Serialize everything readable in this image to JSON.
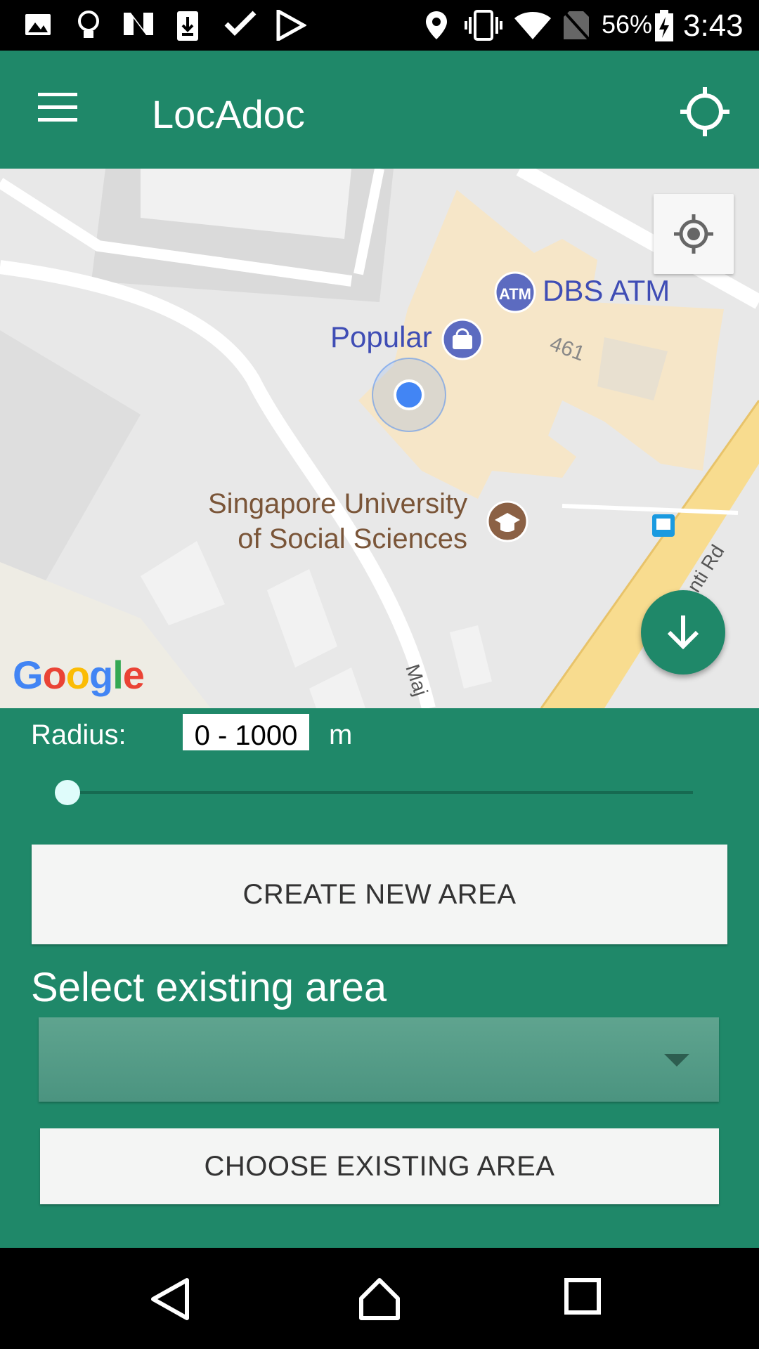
{
  "status_bar": {
    "battery": "56%",
    "time": "3:43",
    "icons": [
      "image-icon",
      "lightbulb-icon",
      "n-icon",
      "download-phone-icon",
      "check-icon",
      "play-store-icon",
      "location-icon",
      "vibrate-icon",
      "wifi-icon",
      "no-sim-icon",
      "battery-charging-icon"
    ]
  },
  "app_bar": {
    "title": "LocAdoc",
    "menu_icon": "hamburger-menu-icon",
    "action_icon": "crosshair-icon"
  },
  "map": {
    "poi_dbs": "DBS ATM",
    "poi_popular": "Popular",
    "poi_suss_line1": "Singapore University",
    "poi_suss_line2": "of Social Sciences",
    "building_number": "461",
    "road_label_1": "enti Rd",
    "road_label_2": "Maj",
    "google_logo": "Google"
  },
  "panel": {
    "radius_label": "Radius:",
    "radius_value": "0 - 1000",
    "radius_unit": "m",
    "slider_value": 0,
    "create_button": "CREATE NEW AREA",
    "select_label": "Select existing area",
    "dropdown_value": "",
    "choose_button": "CHOOSE EXISTING AREA"
  },
  "colors": {
    "primary": "#1f8869",
    "button_bg": "#f4f5f4"
  }
}
